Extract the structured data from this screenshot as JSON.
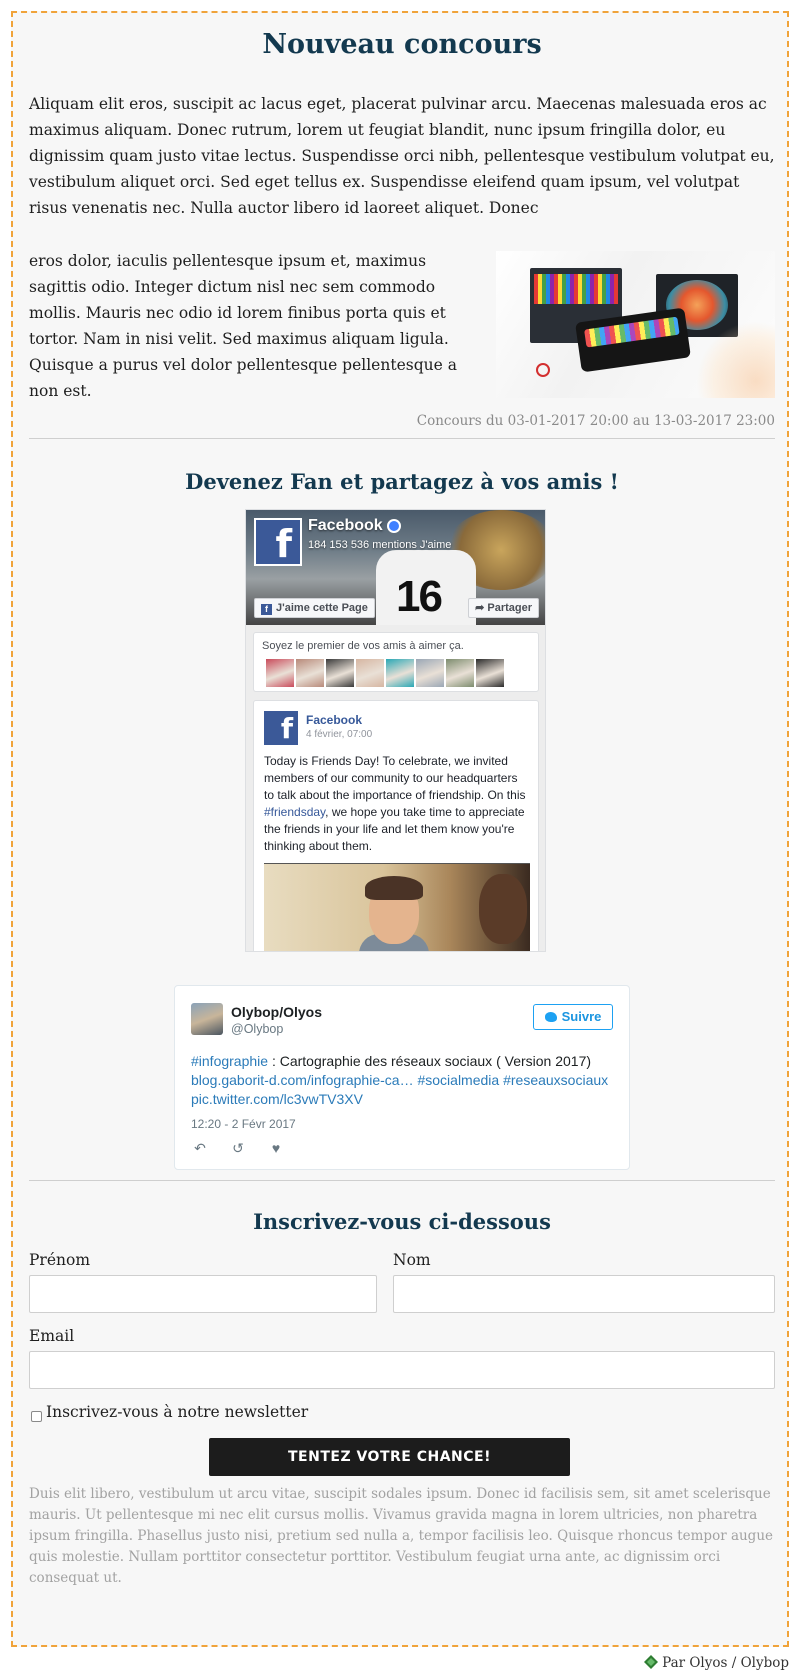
{
  "contest": {
    "title": "Nouveau concours",
    "intro_para1": "Aliquam elit eros, suscipit ac lacus eget, placerat pulvinar arcu. Maecenas malesuada eros ac maximus aliquam. Donec rutrum, lorem ut feugiat blandit, nunc ipsum fringilla dolor, eu dignissim quam justo vitae lectus. Suspendisse orci nibh, pellentesque vestibulum volutpat eu, vestibulum aliquet orci. Sed eget tellus ex. Suspendisse eleifend quam ipsum, vel volutpat risus venenatis nec. Nulla auctor libero id laoreet aliquet. Donec",
    "intro_para2": "eros dolor, iaculis pellentesque ipsum et, maximus sagittis odio. Integer dictum nisl nec sem commodo mollis. Mauris nec odio id lorem finibus porta quis et tortor. Nam in nisi velit. Sed maximus aliquam ligula. Quisque a purus vel dolor pellentesque pellentesque a non est.",
    "dates": "Concours du 03-01-2017 20:00 au 13-03-2017 23:00"
  },
  "social": {
    "heading": "Devenez Fan et partagez à vos amis !",
    "facebook": {
      "page_name": "Facebook",
      "likes": "184 153 536 mentions J'aime",
      "like_button": "J'aime cette Page",
      "share_button": "Partager",
      "friends_text": "Soyez le premier de vos amis à aimer ça.",
      "avatar_colors": [
        "#c94b5b",
        "#b88a7a",
        "#3a3a3a",
        "#d6b6a2",
        "#2aa8b5",
        "#9aa7b5",
        "#7d8c6e",
        "#2b2b2b"
      ],
      "post": {
        "author": "Facebook",
        "date": "4 février, 07:00",
        "text_before": "Today is Friends Day! To celebrate, we invited members of our community to our headquarters to talk about the importance of friendship. On this ",
        "hashtag": "#friendsday",
        "text_after": ", we hope you take time to appreciate the friends in your life and let them know you're thinking about them."
      }
    },
    "twitter": {
      "name": "Olybop/Olyos",
      "handle": "@Olybop",
      "follow_button": "Suivre",
      "tweet_hashtag1": "#infographie",
      "tweet_text1": " : Cartographie des réseaux sociaux ( Version 2017) ",
      "tweet_link": "blog.gaborit-d.com/infographie-ca…",
      "tweet_hashtag2": "#socialmedia",
      "tweet_hashtag3": "#reseauxsociaux",
      "tweet_pic": "pic.twitter.com/lc3vwTV3XV",
      "time": "12:20 - 2 Févr 2017",
      "actions": [
        "reply-icon",
        "retweet-icon",
        "heart-icon"
      ]
    }
  },
  "form": {
    "heading": "Inscrivez-vous ci-dessous",
    "firstname_label": "Prénom",
    "firstname_value": "",
    "lastname_label": "Nom",
    "lastname_value": "",
    "email_label": "Email",
    "email_value": "",
    "newsletter_label": "Inscrivez-vous à notre newsletter",
    "newsletter_checked": false,
    "submit_label": "TENTEZ VOTRE CHANCE!",
    "footer": "Duis elit libero, vestibulum ut arcu vitae, suscipit sodales ipsum. Donec id facilisis sem, sit amet scelerisque mauris. Ut pellentesque mi nec elit cursus mollis. Vivamus gravida magna in lorem ultricies, non pharetra ipsum fringilla. Phasellus justo nisi, pretium sed nulla a, tempor facilisis leo. Quisque rhoncus tempor augue quis molestie. Nullam porttitor consectetur porttitor. Vestibulum feugiat urna ante, ac dignissim orci consequat ut."
  },
  "credit": {
    "text": "Par Olyos / Olybop"
  },
  "colors": {
    "border": "#f0a33a",
    "heading": "#13394f",
    "facebook": "#3b5998",
    "twitter": "#1da1f2",
    "button": "#1c1c1c"
  }
}
